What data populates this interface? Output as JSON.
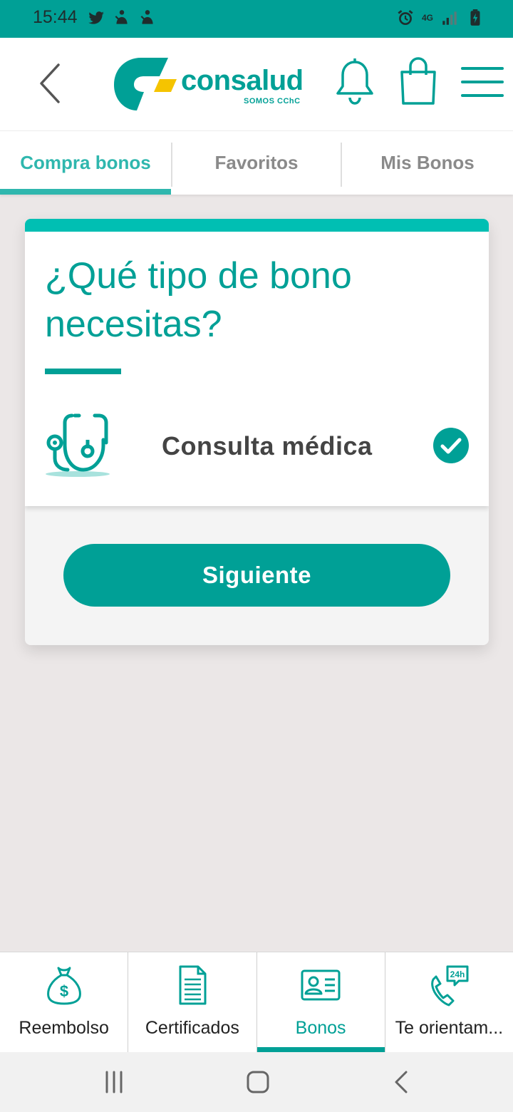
{
  "status_bar": {
    "time": "15:44",
    "network": "4G",
    "left_icons": [
      "twitter-icon",
      "notification-icon",
      "notification-icon"
    ],
    "right_icons": [
      "alarm-icon",
      "network-4g-icon",
      "signal-icon",
      "battery-charging-icon"
    ]
  },
  "header": {
    "logo_text": "consalud",
    "logo_subtitle": "SOMOS CChC",
    "icons": [
      "back-icon",
      "bell-icon",
      "shopping-bag-icon",
      "menu-icon"
    ]
  },
  "tabs": [
    {
      "label": "Compra bonos",
      "active": true
    },
    {
      "label": "Favoritos",
      "active": false
    },
    {
      "label": "Mis Bonos",
      "active": false
    }
  ],
  "card": {
    "title": "¿Qué tipo de bono necesitas?",
    "option": {
      "label": "Consulta médica",
      "icon": "stethoscope-icon",
      "selected": true
    },
    "next_button": "Siguiente"
  },
  "bottom_nav": [
    {
      "label": "Reembolso",
      "icon": "money-bag-icon",
      "active": false
    },
    {
      "label": "Certificados",
      "icon": "document-icon",
      "active": false
    },
    {
      "label": "Bonos",
      "icon": "id-card-icon",
      "active": true
    },
    {
      "label": "Te orientam...",
      "icon": "phone-24h-icon",
      "active": false
    }
  ],
  "colors": {
    "brand": "#00a096",
    "accent": "#2fb7ae",
    "logo_yellow": "#f5c400",
    "background": "#ebe7e7"
  }
}
